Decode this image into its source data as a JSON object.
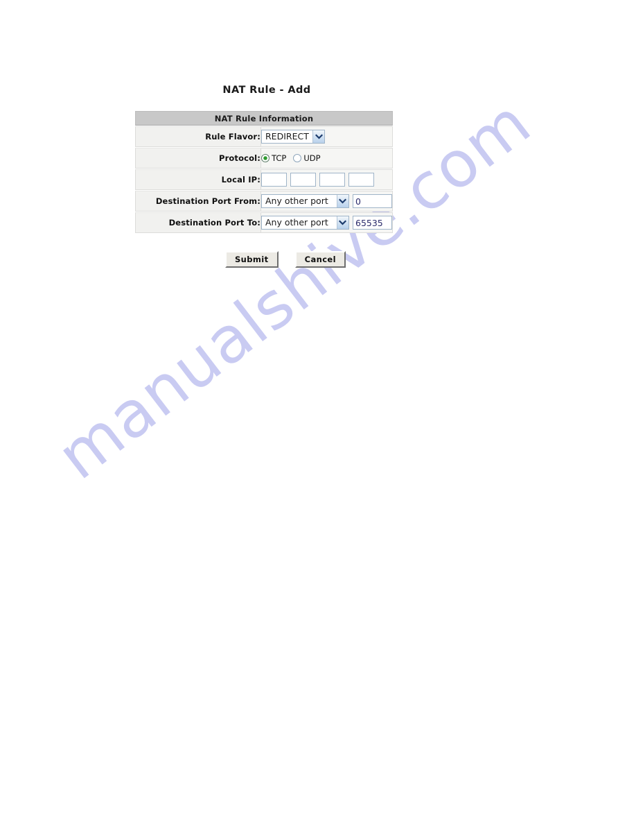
{
  "page": {
    "title": "NAT Rule - Add",
    "watermark": "manualshive.com",
    "watermark_color": "#c9cbf2",
    "background_color": "#ffffff"
  },
  "form": {
    "section_header": "NAT Rule Information",
    "header_bg": "#c8c8c8",
    "rows": [
      {
        "label": "Rule Flavor:",
        "control": "select",
        "selected": "REDIRECT"
      },
      {
        "label": "Protocol:",
        "control": "radio-group",
        "options": [
          {
            "label": "TCP",
            "selected": true
          },
          {
            "label": "UDP",
            "selected": false
          }
        ]
      },
      {
        "label": "Local IP:",
        "control": "ip-octets",
        "octets": [
          "",
          "",
          "",
          ""
        ]
      },
      {
        "label": "Destination Port From:",
        "control": "select-plus-text",
        "selected": "Any other port",
        "value": "0"
      },
      {
        "label": "Destination Port To:",
        "control": "select-plus-text",
        "selected": "Any other port",
        "value": "65535"
      }
    ]
  },
  "buttons": {
    "submit_label": "Submit",
    "cancel_label": "Cancel"
  }
}
